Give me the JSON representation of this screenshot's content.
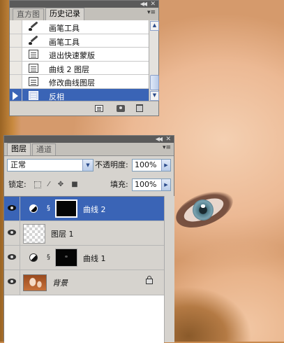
{
  "colors": {
    "selection": "#3a64b6",
    "panel_bg": "#d6d3ce",
    "panel_titlebar": "#5a5a5a"
  },
  "history_panel": {
    "tabs": [
      {
        "label": "直方图",
        "active": false
      },
      {
        "label": "历史记录",
        "active": true
      }
    ],
    "menu_icon": "panel-menu-icon",
    "items": [
      {
        "label": "画笔工具",
        "icon": "brush-icon",
        "selected": false
      },
      {
        "label": "画笔工具",
        "icon": "brush-icon",
        "selected": false
      },
      {
        "label": "退出快速蒙版",
        "icon": "history-state-icon",
        "selected": false
      },
      {
        "label": "曲线 2 图层",
        "icon": "history-state-icon",
        "selected": false
      },
      {
        "label": "修改曲线图层",
        "icon": "history-state-icon",
        "selected": false
      },
      {
        "label": "反相",
        "icon": "history-state-icon",
        "selected": true
      }
    ],
    "footer_icons": [
      "new-document-icon",
      "camera-icon",
      "trash-icon"
    ]
  },
  "layers_panel": {
    "tabs": [
      {
        "label": "图层",
        "active": true
      },
      {
        "label": "通道",
        "active": false
      }
    ],
    "blend_mode": "正常",
    "opacity_label": "不透明度:",
    "opacity_value": "100%",
    "lock_label": "锁定:",
    "fill_label": "填充:",
    "fill_value": "100%",
    "layers": [
      {
        "name": "曲线 2",
        "type": "adjustment",
        "visible": true,
        "selected": true
      },
      {
        "name": "图层 1",
        "type": "pixel",
        "visible": true,
        "selected": false
      },
      {
        "name": "曲线 1",
        "type": "adjustment",
        "visible": true,
        "selected": false
      },
      {
        "name": "背景",
        "type": "background",
        "visible": true,
        "selected": false,
        "locked": true
      }
    ]
  }
}
